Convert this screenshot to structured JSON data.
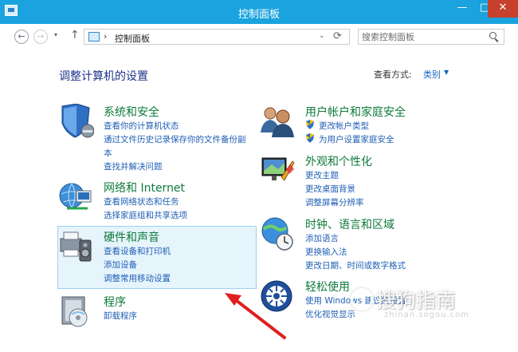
{
  "window": {
    "title": "控制面板",
    "controls": {
      "minimize": "—",
      "maximize": "□",
      "close": "✕"
    }
  },
  "nav": {
    "back": "←",
    "forward": "→",
    "recent": "▾",
    "up": "↑",
    "address": {
      "separator": "›",
      "crumb": "控制面板",
      "dropdown": "⌄",
      "refresh": "⟳"
    },
    "search": {
      "placeholder": "搜索控制面板"
    }
  },
  "page": {
    "title": "调整计算机的设置",
    "view_by_label": "查看方式:",
    "view_by_value": "类别",
    "view_by_arrow": "▼"
  },
  "categories": {
    "system_security": {
      "heading": "系统和安全",
      "links": [
        "查看你的计算机状态",
        "通过文件历史记录保存你的文件备份副",
        "本",
        "查找并解决问题"
      ]
    },
    "network": {
      "heading": "网络和 Internet",
      "links": [
        "查看网络状态和任务",
        "选择家庭组和共享选项"
      ]
    },
    "hardware": {
      "heading": "硬件和声音",
      "links": [
        "查看设备和打印机",
        "添加设备",
        "调整常用移动设置"
      ]
    },
    "programs": {
      "heading": "程序",
      "links": [
        "卸载程序"
      ]
    },
    "user_accounts": {
      "heading": "用户帐户和家庭安全",
      "links": [
        "更改帐户类型",
        "为用户设置家庭安全"
      ]
    },
    "appearance": {
      "heading": "外观和个性化",
      "links": [
        "更改主题",
        "更改桌面背景",
        "调整屏幕分辨率"
      ]
    },
    "clock": {
      "heading": "时钟、语言和区域",
      "links": [
        "添加语言",
        "更换输入法",
        "更改日期、时间或数字格式"
      ]
    },
    "ease": {
      "heading": "轻松使用",
      "links": [
        "使用 Windows 建议的设置",
        "优化视觉显示"
      ]
    }
  },
  "watermark": {
    "text": "搜狗指南",
    "sub": "zhinan.sogou.com"
  },
  "colors": {
    "titlebar": "#1aa3de",
    "heading": "#0d7a3a",
    "link": "#1f5fb4",
    "page_title": "#1e3287",
    "highlight": "#e6f4fc",
    "arrow": "#e02020"
  }
}
